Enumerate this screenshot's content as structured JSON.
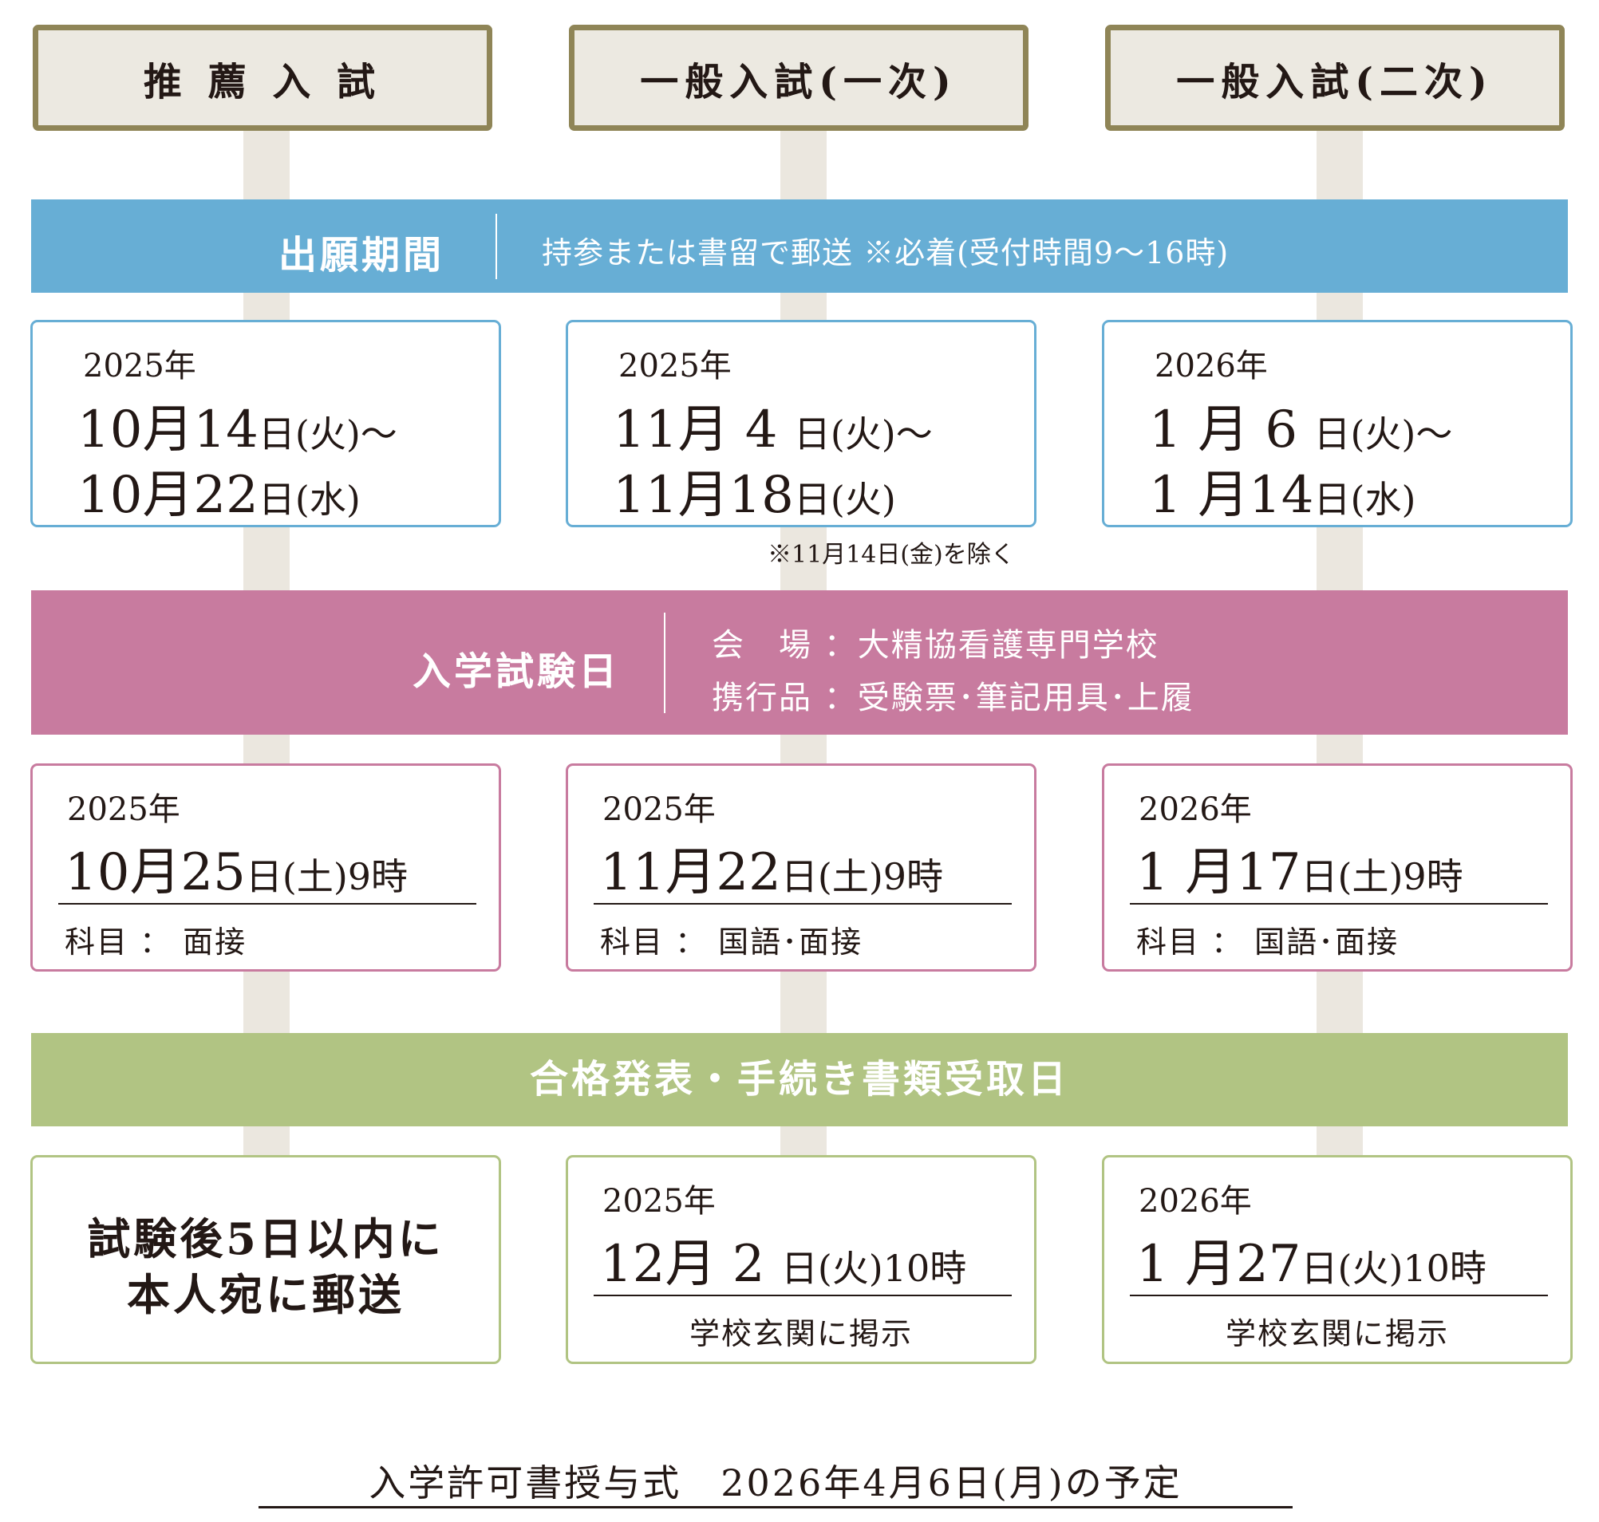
{
  "columns": [
    {
      "title": "推 薦 入 試"
    },
    {
      "title": "一般入試(一次)"
    },
    {
      "title": "一般入試(二次)"
    }
  ],
  "application": {
    "label": "出願期間",
    "note": "持参または書留で郵送 ※必着(受付時間9～16時)",
    "items": [
      {
        "year": "2025年",
        "from_num": "10月14",
        "from_day": "日(火)～",
        "to_num": "10月22",
        "to_day": "日(水)"
      },
      {
        "year": "2025年",
        "from_num": "11月 4 ",
        "from_day": "日(火)～",
        "to_num": "11月18",
        "to_day": "日(火)"
      },
      {
        "year": "2026年",
        "from_num": " 1 月 6 ",
        "from_day": "日(火)～",
        "to_num": " 1 月14",
        "to_day": "日(水)"
      }
    ],
    "exclusion_note": "※11月14日(金)を除く"
  },
  "exam": {
    "label": "入学試験日",
    "venue_line": "会　場 ：大精協看護専門学校",
    "items_line": "携行品 ：受験票･筆記用具･上履",
    "items": [
      {
        "year": "2025年",
        "date_num": "10月25",
        "date_day": "日(土)9時",
        "subject": "科目 ： 面接"
      },
      {
        "year": "2025年",
        "date_num": "11月22",
        "date_day": "日(土)9時",
        "subject": "科目 ： 国語･面接"
      },
      {
        "year": "2026年",
        "date_num": " 1 月17",
        "date_day": "日(土)9時",
        "subject": "科目 ： 国語･面接"
      }
    ]
  },
  "result": {
    "label": "合格発表・手続き書類受取日",
    "mail_line1": "試験後5日以内に",
    "mail_line2": "本人宛に郵送",
    "items": [
      {
        "year": "2025年",
        "date_num": "12月 2 ",
        "date_day": "日(火)10時",
        "place": "学校玄関に掲示"
      },
      {
        "year": "2026年",
        "date_num": " 1 月27",
        "date_day": "日(火)10時",
        "place": "学校玄関に掲示"
      }
    ]
  },
  "ceremony": {
    "text": "入学許可書授与式　2026年4月6日(月)の予定"
  },
  "colors": {
    "head_border": "#8f8557",
    "head_fill": "#ece9e1",
    "connector": "#ebe7df",
    "blue": "#67aed5",
    "pink": "#c87b9f",
    "green": "#b1c483"
  }
}
